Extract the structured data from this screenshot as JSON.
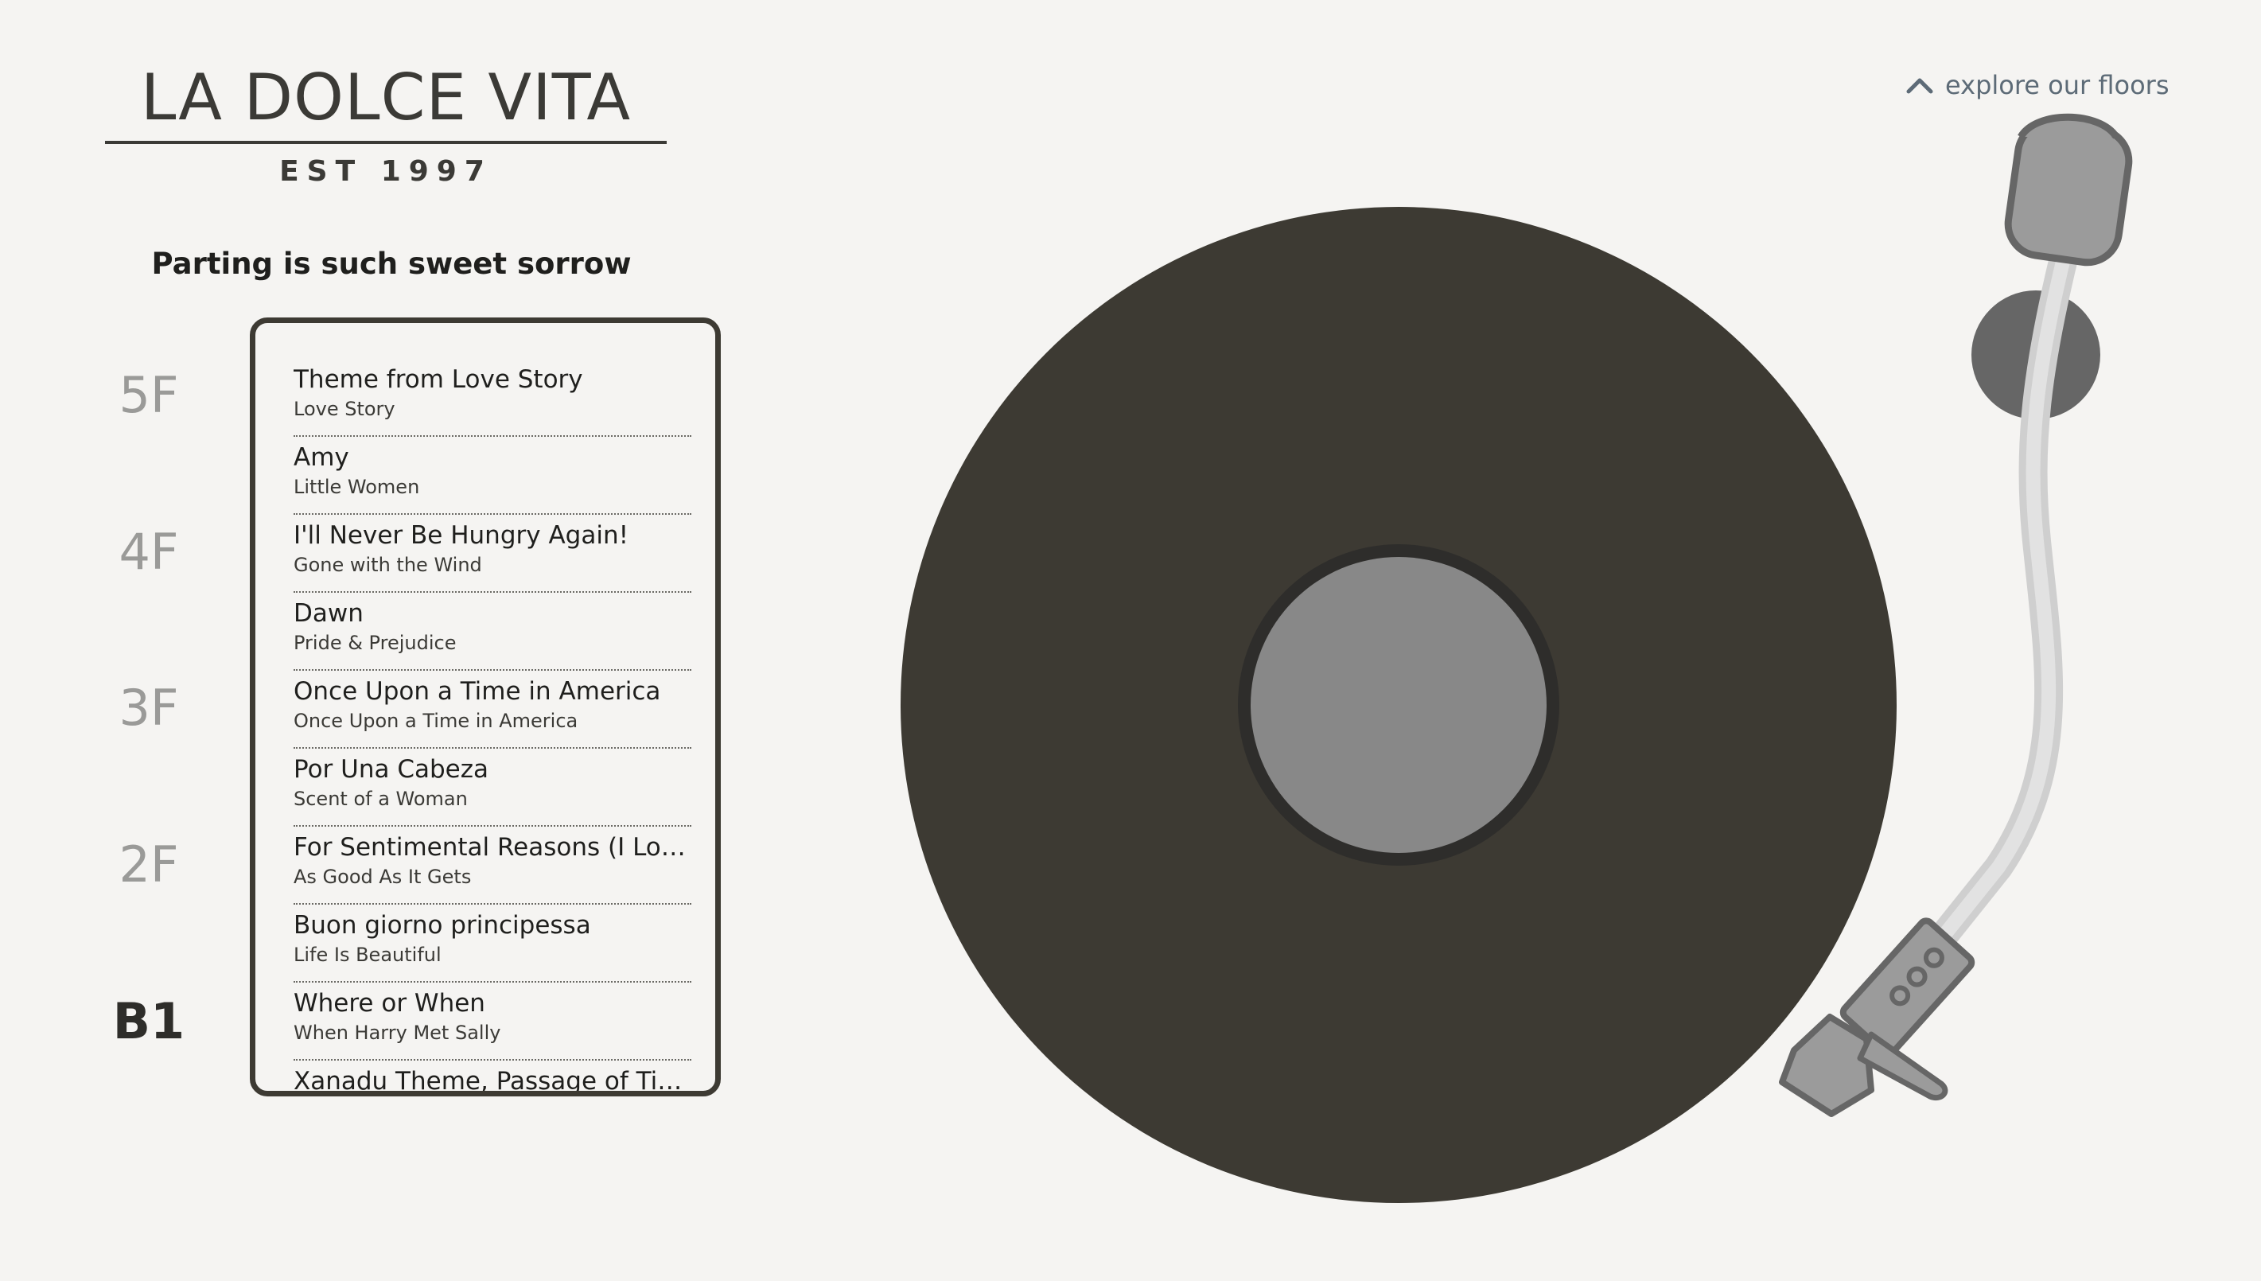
{
  "brand": {
    "title": "LA DOLCE VITA",
    "established": "EST 1997"
  },
  "subtitle": "Parting is such sweet sorrow",
  "nav": {
    "explore_label": "explore our floors"
  },
  "floors": [
    {
      "label": "5F",
      "active": false
    },
    {
      "label": "4F",
      "active": false
    },
    {
      "label": "3F",
      "active": false
    },
    {
      "label": "2F",
      "active": false
    },
    {
      "label": "B1",
      "active": true
    }
  ],
  "tracks": [
    {
      "title": "Theme from Love Story",
      "film": "Love Story"
    },
    {
      "title": "Amy",
      "film": "Little Women"
    },
    {
      "title": "I'll Never Be Hungry Again!",
      "film": "Gone with the Wind"
    },
    {
      "title": "Dawn",
      "film": "Pride & Prejudice"
    },
    {
      "title": "Once Upon a Time in America",
      "film": "Once Upon a Time in America"
    },
    {
      "title": "Por Una Cabeza",
      "film": "Scent of a Woman"
    },
    {
      "title": "For Sentimental Reasons (I Love Y...",
      "film": "As Good As It Gets"
    },
    {
      "title": "Buon giorno principessa",
      "film": "Life Is Beautiful"
    },
    {
      "title": "Where or When",
      "film": "When Harry Met Sally"
    },
    {
      "title": "Xanadu Theme, Passage of Time",
      "film": ""
    }
  ],
  "colors": {
    "background": "#f5f4f2",
    "record": "#3d3a33",
    "label": "#888888",
    "tonearm": "#9b9b9b",
    "accent_text": "#5d6b77"
  },
  "icons": {
    "explore": "chevron-up-icon"
  }
}
